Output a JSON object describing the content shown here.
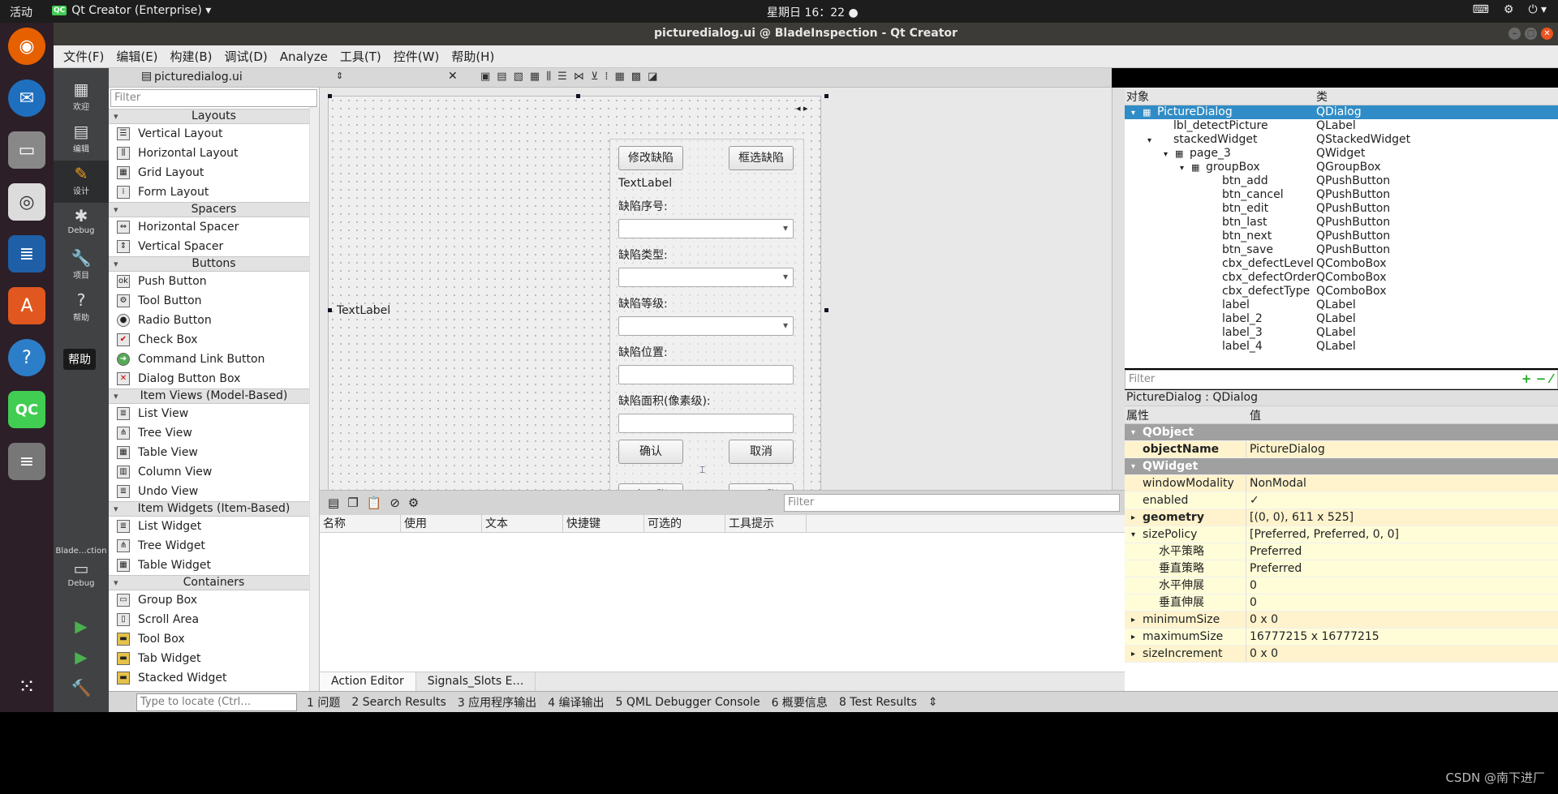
{
  "topbar": {
    "activities": "活动",
    "app": "Qt Creator (Enterprise) ▾",
    "app_icon": "QC",
    "clock": "星期日 16：22 ●",
    "tray": [
      "⌨",
      "⚙",
      "⏻ ▾"
    ]
  },
  "window": {
    "title": "picturedialog.ui @ BladeInspection - Qt Creator",
    "controls": [
      "–",
      "□",
      "✕"
    ]
  },
  "dock": {
    "tooltip": "帮助"
  },
  "menu": [
    "文件(F)",
    "编辑(E)",
    "构建(B)",
    "调试(D)",
    "Analyze",
    "工具(T)",
    "控件(W)",
    "帮助(H)"
  ],
  "modes": [
    {
      "icon": "▦",
      "label": "欢迎"
    },
    {
      "icon": "▤",
      "label": "编辑"
    },
    {
      "icon": "✎",
      "label": "设计"
    },
    {
      "icon": "✱",
      "label": "Debug"
    },
    {
      "icon": "🔧",
      "label": "项目"
    },
    {
      "icon": "?",
      "label": "帮助"
    }
  ],
  "run": {
    "target": "Blade…ction",
    "kit": "Debug",
    "buttons": [
      "▶",
      "▶",
      "🔨"
    ]
  },
  "file": {
    "name": "picturedialog.ui",
    "close": "✕"
  },
  "widgetbox": {
    "filter": "Filter",
    "sections": [
      {
        "title": "Layouts",
        "items": [
          "Vertical Layout",
          "Horizontal Layout",
          "Grid Layout",
          "Form Layout"
        ]
      },
      {
        "title": "Spacers",
        "items": [
          "Horizontal Spacer",
          "Vertical Spacer"
        ]
      },
      {
        "title": "Buttons",
        "items": [
          "Push Button",
          "Tool Button",
          "Radio Button",
          "Check Box",
          "Command Link Button",
          "Dialog Button Box"
        ]
      },
      {
        "title": "Item Views (Model-Based)",
        "items": [
          "List View",
          "Tree View",
          "Table View",
          "Column View",
          "Undo View"
        ]
      },
      {
        "title": "Item Widgets (Item-Based)",
        "items": [
          "List Widget",
          "Tree Widget",
          "Table Widget"
        ]
      },
      {
        "title": "Containers",
        "items": [
          "Group Box",
          "Scroll Area",
          "Tool Box",
          "Tab Widget",
          "Stacked Widget"
        ]
      }
    ]
  },
  "form": {
    "left_label": "TextLabel",
    "stack_nav": "◂ ▸",
    "btn_edit": "修改缺陷",
    "btn_select": "框选缺陷",
    "text_label": "TextLabel",
    "lbl_order": "缺陷序号:",
    "lbl_type": "缺陷类型:",
    "lbl_level": "缺陷等级:",
    "lbl_pos": "缺陷位置:",
    "lbl_area": "缺陷面积(像素级):",
    "btn_confirm": "确认",
    "btn_cancel": "取消",
    "btn_prev": "上一张",
    "btn_next": "下一张"
  },
  "objinspector": {
    "col_obj": "对象",
    "col_class": "类",
    "rows": [
      {
        "name": "PictureDialog",
        "cls": "QDialog",
        "indent": 0,
        "arrow": "▾",
        "icon": "▦"
      },
      {
        "name": "lbl_detectPicture",
        "cls": "QLabel",
        "indent": 1,
        "arrow": "",
        "icon": ""
      },
      {
        "name": "stackedWidget",
        "cls": "QStackedWidget",
        "indent": 1,
        "arrow": "▾",
        "icon": ""
      },
      {
        "name": "page_3",
        "cls": "QWidget",
        "indent": 2,
        "arrow": "▾",
        "icon": "▦"
      },
      {
        "name": "groupBox",
        "cls": "QGroupBox",
        "indent": 3,
        "arrow": "▾",
        "icon": "▦"
      },
      {
        "name": "btn_add",
        "cls": "QPushButton",
        "indent": 4,
        "arrow": "",
        "icon": ""
      },
      {
        "name": "btn_cancel",
        "cls": "QPushButton",
        "indent": 4,
        "arrow": "",
        "icon": ""
      },
      {
        "name": "btn_edit",
        "cls": "QPushButton",
        "indent": 4,
        "arrow": "",
        "icon": ""
      },
      {
        "name": "btn_last",
        "cls": "QPushButton",
        "indent": 4,
        "arrow": "",
        "icon": ""
      },
      {
        "name": "btn_next",
        "cls": "QPushButton",
        "indent": 4,
        "arrow": "",
        "icon": ""
      },
      {
        "name": "btn_save",
        "cls": "QPushButton",
        "indent": 4,
        "arrow": "",
        "icon": ""
      },
      {
        "name": "cbx_defectLevel",
        "cls": "QComboBox",
        "indent": 4,
        "arrow": "",
        "icon": ""
      },
      {
        "name": "cbx_defectOrder",
        "cls": "QComboBox",
        "indent": 4,
        "arrow": "",
        "icon": ""
      },
      {
        "name": "cbx_defectType",
        "cls": "QComboBox",
        "indent": 4,
        "arrow": "",
        "icon": ""
      },
      {
        "name": "label",
        "cls": "QLabel",
        "indent": 4,
        "arrow": "",
        "icon": ""
      },
      {
        "name": "label_2",
        "cls": "QLabel",
        "indent": 4,
        "arrow": "",
        "icon": ""
      },
      {
        "name": "label_3",
        "cls": "QLabel",
        "indent": 4,
        "arrow": "",
        "icon": ""
      },
      {
        "name": "label_4",
        "cls": "QLabel",
        "indent": 4,
        "arrow": "",
        "icon": ""
      }
    ],
    "filter": "Filter"
  },
  "propinspector": {
    "title": "PictureDialog : QDialog",
    "col_prop": "属性",
    "col_val": "值",
    "rows": [
      {
        "name": "QObject",
        "val": "",
        "type": "sec",
        "arrow": "▾"
      },
      {
        "name": "objectName",
        "val": "PictureDialog",
        "type": "y1 bd",
        "arrow": ""
      },
      {
        "name": "QWidget",
        "val": "",
        "type": "sec",
        "arrow": "▾"
      },
      {
        "name": "windowModality",
        "val": "NonModal",
        "type": "y1",
        "arrow": ""
      },
      {
        "name": "enabled",
        "val": "✓",
        "type": "y2",
        "arrow": ""
      },
      {
        "name": "geometry",
        "val": "[(0, 0), 611 x 525]",
        "type": "y1 bd",
        "arrow": "▸"
      },
      {
        "name": "sizePolicy",
        "val": "[Preferred, Preferred, 0, 0]",
        "type": "y2",
        "arrow": "▾"
      },
      {
        "name": "水平策略",
        "val": "Preferred",
        "type": "y2 sub",
        "arrow": ""
      },
      {
        "name": "垂直策略",
        "val": "Preferred",
        "type": "y2 sub",
        "arrow": ""
      },
      {
        "name": "水平伸展",
        "val": "0",
        "type": "y2 sub",
        "arrow": ""
      },
      {
        "name": "垂直伸展",
        "val": "0",
        "type": "y2 sub",
        "arrow": ""
      },
      {
        "name": "minimumSize",
        "val": "0 x 0",
        "type": "y1",
        "arrow": "▸"
      },
      {
        "name": "maximumSize",
        "val": "16777215 x 16777215",
        "type": "y2",
        "arrow": "▸"
      },
      {
        "name": "sizeIncrement",
        "val": "0 x 0",
        "type": "y1",
        "arrow": "▸"
      }
    ]
  },
  "actioneditor": {
    "filter": "Filter",
    "columns": [
      "名称",
      "使用",
      "文本",
      "快捷键",
      "可选的",
      "工具提示"
    ],
    "tabs": [
      "Action Editor",
      "Signals_Slots E…"
    ]
  },
  "statusbar": {
    "locate": "Type to locate (Ctrl…",
    "panes": [
      "1 问题",
      "2 Search Results",
      "3 应用程序输出",
      "4 编译输出",
      "5 QML Debugger Console",
      "6 概要信息",
      "8 Test Results",
      "⇕"
    ]
  },
  "watermark": "CSDN @南下进厂"
}
